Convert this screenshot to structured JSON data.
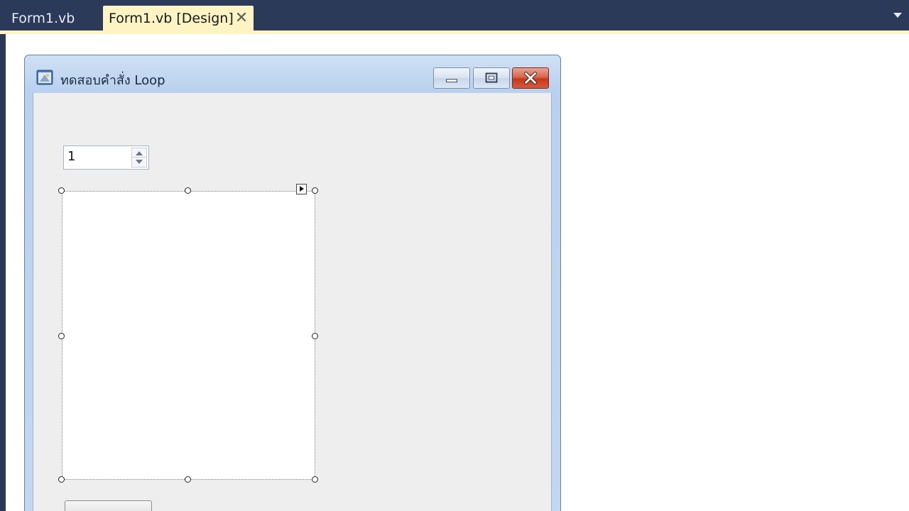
{
  "tabs": [
    {
      "label": "Form1.vb",
      "active": false
    },
    {
      "label": "Form1.vb [Design]",
      "active": true
    }
  ],
  "tab_close_glyph": "✕",
  "form": {
    "title": "ทดสอบคำสั่ง Loop",
    "icon": "form-app-icon",
    "caption_buttons": [
      "minimize-icon",
      "maximize-icon",
      "close-icon"
    ]
  },
  "numeric_updown": {
    "value": "1"
  },
  "colors": {
    "ide_background": "#293955",
    "active_tab": "#fdf3c3",
    "design_surface": "#ffffff",
    "form_client": "#eeeeee",
    "close_button": "#c6391c"
  }
}
